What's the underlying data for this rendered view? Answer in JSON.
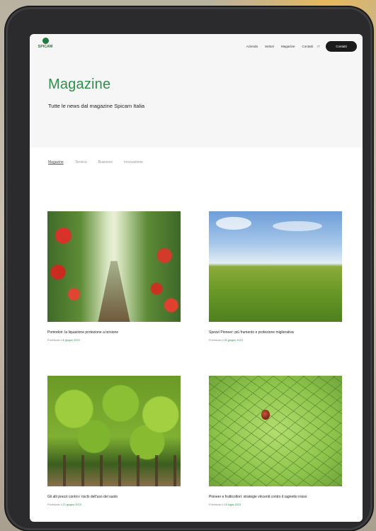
{
  "header": {
    "logo_text": "SPICAM",
    "nav": [
      "Azienda",
      "Settori",
      "Magazine",
      "Contatti"
    ],
    "lang": "IT",
    "cta_label": "Contatti"
  },
  "hero": {
    "title": "Magazine",
    "subtitle": "Tutte le news dal magazine Spicam Italia"
  },
  "tabs": [
    "Magazine",
    "Tecnica",
    "Business",
    "Innovazione"
  ],
  "cards": [
    {
      "title": "Pomodori: la liquazione protezione a torsione",
      "meta_prefix": "Pubblicato il",
      "date": "8 giugno 2023",
      "image": "tomato-greenhouse"
    },
    {
      "title": "Spezzi Pioneer: più frumento e protezione migliorativa",
      "meta_prefix": "Pubblicato il",
      "date": "30 giugno 2023",
      "image": "wheat-field"
    },
    {
      "title": "Gli alti prezzi contro i rischi dell'uso del suolo",
      "meta_prefix": "Pubblicato il",
      "date": "22 giugno 2023",
      "image": "orchard"
    },
    {
      "title": "Pioneer e frutticoltori: strategie vincenti contro il ragnetto rosso",
      "meta_prefix": "Pubblicato il",
      "date": "15 luglio 2023",
      "image": "leaf-mite"
    }
  ],
  "colors": {
    "accent": "#2f8f4a",
    "cta": "#1b1b1b",
    "hero_bg": "#f6f6f6"
  }
}
